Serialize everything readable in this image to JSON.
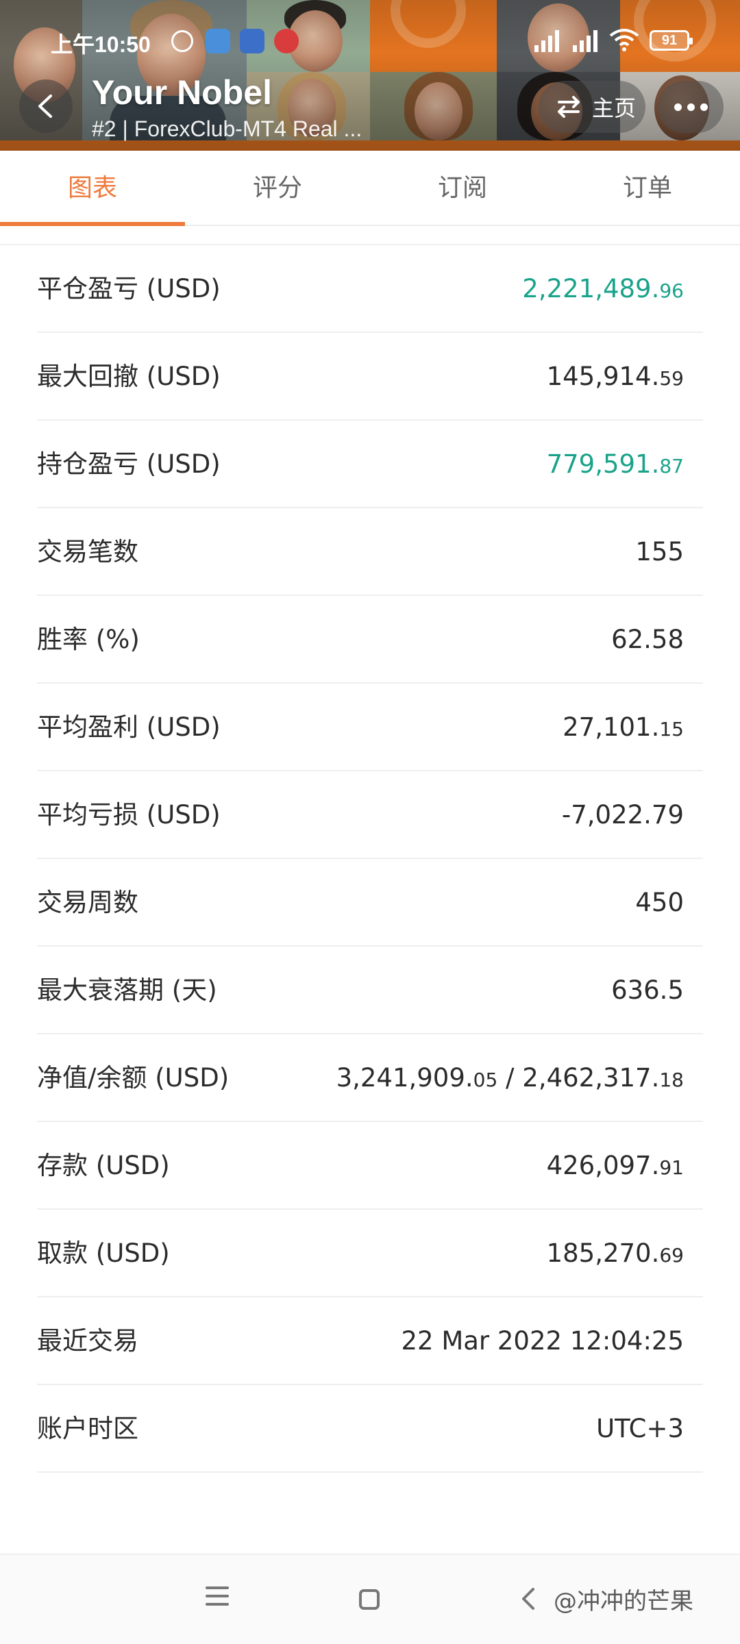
{
  "status_bar": {
    "time": "上午10:50",
    "battery": "91"
  },
  "header": {
    "title": "Your Nobel",
    "subtitle": "#2 | ForexClub-MT4 Real ...",
    "home_label": "主页"
  },
  "tabs": [
    {
      "label": "图表",
      "active": true
    },
    {
      "label": "评分",
      "active": false
    },
    {
      "label": "订阅",
      "active": false
    },
    {
      "label": "订单",
      "active": false
    }
  ],
  "stats": [
    {
      "label": "平仓盈亏 (USD)",
      "main": "2,221,489.",
      "cents": "96",
      "color": "green"
    },
    {
      "label": "最大回撤 (USD)",
      "main": "145,914.",
      "cents": "59"
    },
    {
      "label": "持仓盈亏 (USD)",
      "main": "779,591.",
      "cents": "87",
      "color": "green"
    },
    {
      "label": "交易笔数",
      "main": "155",
      "cents": ""
    },
    {
      "label": "胜率 (%)",
      "main": "62.58",
      "cents": ""
    },
    {
      "label": "平均盈利 (USD)",
      "main": "27,101.",
      "cents": "15"
    },
    {
      "label": "平均亏损 (USD)",
      "main": "-7,022.79",
      "cents": ""
    },
    {
      "label": "交易周数",
      "main": "450",
      "cents": ""
    },
    {
      "label": "最大衰落期 (天)",
      "main": "636.5",
      "cents": ""
    },
    {
      "label": "净值/余额 (USD)",
      "main": "3,241,909.",
      "cents": "05",
      "main2": " / 2,462,317.",
      "cents2": "18"
    },
    {
      "label": "存款 (USD)",
      "main": "426,097.",
      "cents": "91"
    },
    {
      "label": "取款 (USD)",
      "main": "185,270.",
      "cents": "69"
    },
    {
      "label": "最近交易",
      "main": "22 Mar 2022 12:04:25",
      "cents": ""
    },
    {
      "label": "账户时区",
      "main": "UTC+3",
      "cents": ""
    }
  ],
  "watermark": "@冲冲的芒果",
  "colors": {
    "accent": "#ee7a3c",
    "profit": "#1aa38a",
    "header_bg": "#e8661f"
  }
}
